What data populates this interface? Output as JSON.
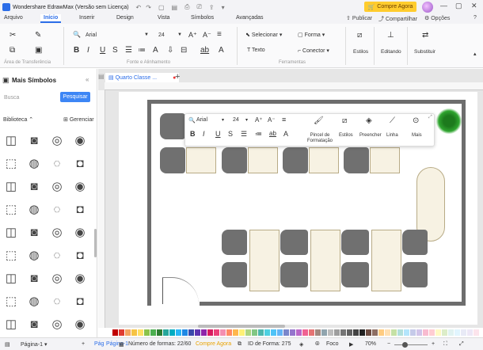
{
  "app": {
    "title": "Wondershare EdrawMax (Versão sem Licença)",
    "buy_label": "Compre Agora"
  },
  "menu": {
    "tabs": [
      "Arquivo",
      "Início",
      "Inserir",
      "Design",
      "Vista",
      "Símbolos",
      "Avançadas"
    ],
    "active": "Início",
    "publish": "Publicar",
    "share": "Compartilhar",
    "options": "Opções",
    "help": "?"
  },
  "ribbon": {
    "font_name": "Arial",
    "font_size": "24",
    "select": "Selecionar",
    "shape": "Forma",
    "text": "Texto",
    "connector": "Conector",
    "styles": "Estilos",
    "editing": "Editando",
    "replace": "Substituir",
    "groups": [
      "Área de Transferência",
      "Fonte e Alinhamento",
      "Ferramentas"
    ]
  },
  "left_panel": {
    "title": "Mais Símbolos",
    "search_placeholder": "Busca",
    "search_button": "Pesquisar",
    "library": "Biblioteca",
    "manage": "Gerenciar"
  },
  "document": {
    "tab": "Quarto Classe ..."
  },
  "floating_toolbar": {
    "font_name": "Arial",
    "font_size": "24",
    "painter": "Pincel de Formatação",
    "styles": "Estilos",
    "fill": "Preencher",
    "line": "Linha",
    "more": "Mais"
  },
  "status": {
    "page_select": "Página-1",
    "page_tab": "Pág",
    "page_tab_name": "Página-1",
    "shapes_count": "Número de formas: 22/60",
    "buy": "Compre Agora",
    "shape_id": "ID de Forma: 275",
    "focus": "Foco",
    "zoom": "70%"
  },
  "colors": {
    "accent": "#2b6de8",
    "buy": "#ffcc2e",
    "wall": "#6d6d6d",
    "desk": "#f7f2e3"
  }
}
